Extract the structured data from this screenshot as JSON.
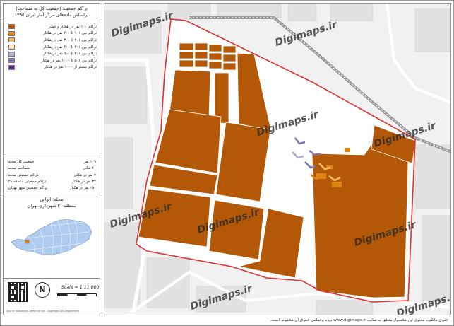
{
  "panel": {
    "title_line1": "تراکم جمعیت (جمعیت کل به مساحت)",
    "title_line2": "براساس داده‌های مرکز آمار ایران ۱۳۹۵",
    "legend": [
      {
        "label": "تراکم ۱۰۰ نفر در هکتار و کمتر",
        "color": "#b35806"
      },
      {
        "label": "تراکم بین ۱۰۱ تا ۲۰۰ نفر در هکتار",
        "color": "#e08214"
      },
      {
        "label": "تراکم بین ۲۰۱ تا ۳۰۰ نفر در هکتار",
        "color": "#fdb863"
      },
      {
        "label": "تراکم بین ۳۰۱ تا ۴۰۰ نفر در هکتار",
        "color": "#fee0b6"
      },
      {
        "label": "تراکم بین ۴۰۱ تا ۵۰۰ نفر در هکتار",
        "color": "#b2abd2"
      },
      {
        "label": "تراکم بین ۵۰۱ تا ۱۰۰۰ نفر در هکتار",
        "color": "#8073ac"
      },
      {
        "label": "تراکم بیشتر از ۱۰۰۰ نفر در هکتار",
        "color": "#542788"
      }
    ],
    "stats": [
      {
        "label": "جمعیت کل محله:",
        "value": "۱۰۹ نفر"
      },
      {
        "label": "مساحت محله:",
        "value": "۶۱ هکتار"
      },
      {
        "label": "تراکم جمعیتی محله:",
        "value": "۲ نفر در هکتار"
      },
      {
        "label": "تراکم جمعیتی منطقه ۲۱:",
        "value": "۳۷ نفر در هکتار"
      },
      {
        "label": "تراکم جمعیتی شهر تهران:",
        "value": "۱۵۰ نفر در هکتار"
      }
    ],
    "mahalleh": "محله: ایرانی",
    "mantaghe": "منطقه ۲۱ شهرداری تهران",
    "scale": "Scale = 1:11,000",
    "north": "N",
    "footer": "Source: Statistical Center of Iran - Digimaps GIS Department"
  },
  "watermark": "Digimaps.ir",
  "bottom_text": "حقوق مالکیت معنوی این محصول متعلق به سایت www.digimaps.ir بوده و تمامی حقوق آن محفوظ است.",
  "colors": {
    "block": "#b35806",
    "orange_small": "#e08214",
    "boundary": "#e03030",
    "purple_feature": "#8073ac"
  },
  "icons": {
    "north": "north-arrow-icon",
    "qr": "qr-code-icon"
  }
}
